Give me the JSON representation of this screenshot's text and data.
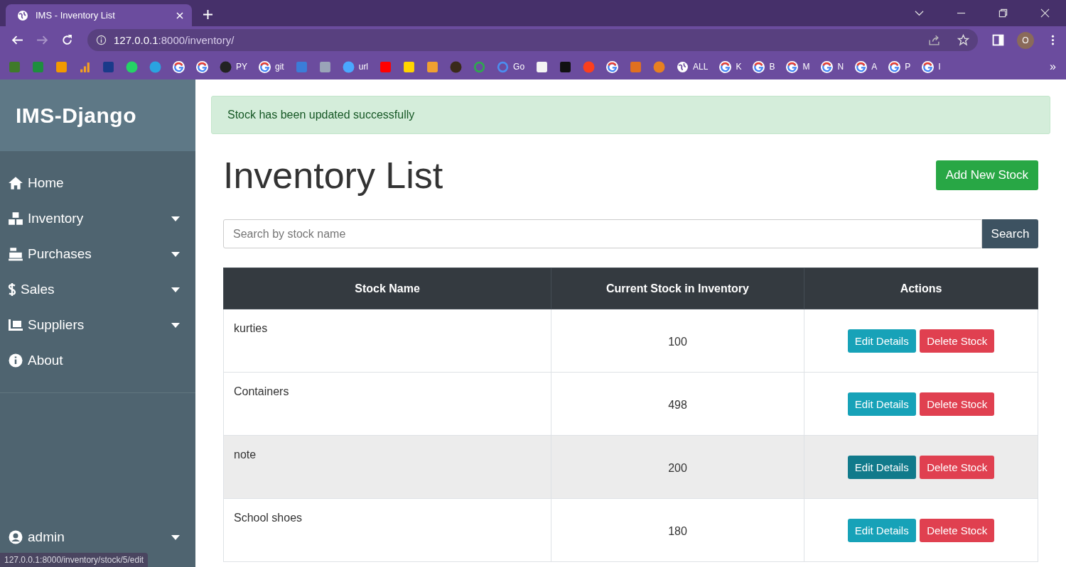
{
  "browser": {
    "tab": {
      "title": "IMS - Inventory List",
      "selected": true
    },
    "address": {
      "host": "127.0.0.1",
      "path": ":8000/inventory/"
    },
    "profile": "O",
    "bookmarks": [
      {
        "kind": "square",
        "color": "#3f7a2a"
      },
      {
        "kind": "square",
        "color": "#1e8e3e"
      },
      {
        "kind": "square",
        "color": "#f29900"
      },
      {
        "kind": "bars",
        "color": "#f4a020"
      },
      {
        "kind": "square",
        "color": "#1a3a8a"
      },
      {
        "kind": "circle",
        "color": "#25d366"
      },
      {
        "kind": "circle",
        "color": "#2aa3e0"
      },
      {
        "kind": "google"
      },
      {
        "kind": "google"
      },
      {
        "kind": "circle",
        "color": "#222222",
        "label": "PY"
      },
      {
        "kind": "google",
        "label": "git"
      },
      {
        "kind": "square",
        "color": "#3b7dd8"
      },
      {
        "kind": "square",
        "color": "#9aa4b8"
      },
      {
        "kind": "circle",
        "color": "#4aa8ff",
        "label": "url"
      },
      {
        "kind": "square",
        "color": "#ff0000"
      },
      {
        "kind": "square",
        "color": "#ffd400"
      },
      {
        "kind": "square",
        "color": "#f0a030"
      },
      {
        "kind": "circle",
        "color": "#3a2a1a"
      },
      {
        "kind": "ring",
        "color": "#2fa84f"
      },
      {
        "kind": "ring",
        "color": "#4b8ef0",
        "label": "Go"
      },
      {
        "kind": "square",
        "color": "#f4f4f4"
      },
      {
        "kind": "square",
        "color": "#111111"
      },
      {
        "kind": "circle",
        "color": "#fc3f1d"
      },
      {
        "kind": "google"
      },
      {
        "kind": "square",
        "color": "#e07020"
      },
      {
        "kind": "circle",
        "color": "#e88020"
      },
      {
        "kind": "globe",
        "label": "ALL"
      },
      {
        "kind": "google",
        "label": "K"
      },
      {
        "kind": "google",
        "label": "B"
      },
      {
        "kind": "google",
        "label": "M"
      },
      {
        "kind": "google",
        "label": "N"
      },
      {
        "kind": "google",
        "label": "A"
      },
      {
        "kind": "google",
        "label": "P"
      },
      {
        "kind": "google",
        "label": "I"
      }
    ],
    "more": "»"
  },
  "sidebar": {
    "brand": "IMS-Django",
    "items": [
      {
        "label": "Home",
        "dropdown": false
      },
      {
        "label": "Inventory",
        "dropdown": true
      },
      {
        "label": "Purchases",
        "dropdown": true
      },
      {
        "label": "Sales",
        "dropdown": true
      },
      {
        "label": "Suppliers",
        "dropdown": true
      },
      {
        "label": "About",
        "dropdown": false
      }
    ],
    "user": {
      "label": "admin",
      "dropdown": true
    }
  },
  "alert": "Stock has been updated successfully",
  "page": {
    "title": "Inventory List",
    "add_button": "Add New Stock"
  },
  "search": {
    "placeholder": "Search by stock name",
    "button": "Search"
  },
  "table": {
    "columns": [
      "Stock Name",
      "Current Stock in Inventory",
      "Actions"
    ],
    "rows": [
      {
        "name": "kurties",
        "stock": "100",
        "edit": "Edit Details",
        "delete": "Delete Stock",
        "highlighted": false
      },
      {
        "name": "Containers",
        "stock": "498",
        "edit": "Edit Details",
        "delete": "Delete Stock",
        "highlighted": false
      },
      {
        "name": "note",
        "stock": "200",
        "edit": "Edit Details",
        "delete": "Delete Stock",
        "highlighted": true
      },
      {
        "name": "School shoes",
        "stock": "180",
        "edit": "Edit Details",
        "delete": "Delete Stock",
        "highlighted": false
      }
    ]
  },
  "status_url": "127.0.0.1:8000/inventory/stock/5/edit"
}
